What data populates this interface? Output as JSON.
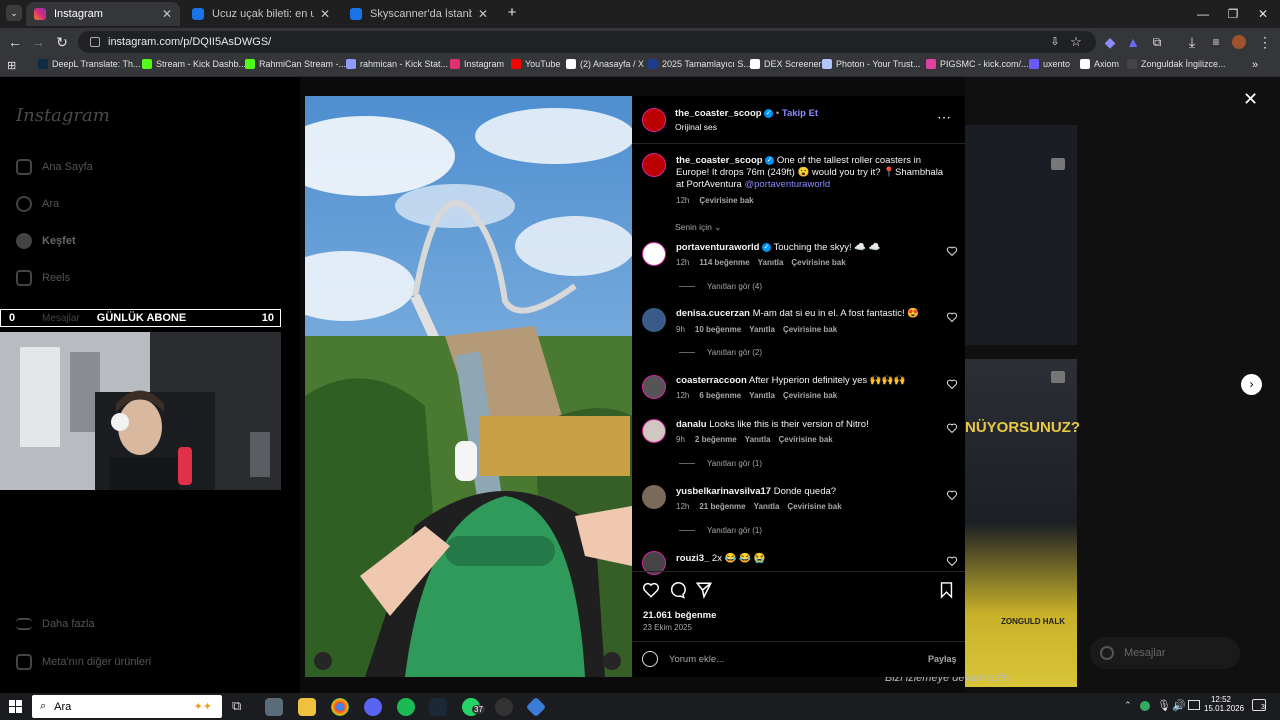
{
  "browser": {
    "tabs": [
      {
        "title": "Instagram",
        "active": true,
        "color": "#e1306c"
      },
      {
        "title": "Ucuz uçak bileti: en uygun uçak",
        "active": false,
        "color": "#1a73e8"
      },
      {
        "title": "Skyscanner'da İstanbul-Bakü a",
        "active": false,
        "color": "#1a73e8"
      }
    ],
    "url": "instagram.com/p/DQII5AsDWGS/"
  },
  "bookmarks": [
    {
      "label": "DeepL Translate: Th...",
      "color": "#0f2b46"
    },
    {
      "label": "Stream - Kick Dashb...",
      "color": "#53fc18"
    },
    {
      "label": "RahmiCan Stream -...",
      "color": "#53fc18"
    },
    {
      "label": "rahmican - Kick Stat...",
      "color": "#8f9bff"
    },
    {
      "label": "Instagram",
      "color": "#e1306c"
    },
    {
      "label": "YouTube",
      "color": "#ff0000"
    },
    {
      "label": "(2) Anasayfa / X",
      "color": "#ffffff"
    },
    {
      "label": "2025 Tamamlayıcı S...",
      "color": "#1a3d8f"
    },
    {
      "label": "DEX Screener",
      "color": "#ffffff"
    },
    {
      "label": "Photon - Your Trust...",
      "color": "#b0c4ff"
    },
    {
      "label": "PIGSMC - kick.com/...",
      "color": "#e040a0"
    },
    {
      "label": "uxento",
      "color": "#6b5bff"
    },
    {
      "label": "Axiom",
      "color": "#ffffff"
    },
    {
      "label": "Zonguldak İngilizce...",
      "color": "#444"
    }
  ],
  "instagram": {
    "logo": "Instagram",
    "nav": [
      "Ana Sayfa",
      "Ara",
      "Keşfet",
      "Reels",
      "Mesajlar",
      "Daha fazla",
      "Meta'nın diğer ürünleri"
    ],
    "messages_button": "Mesajlar",
    "bg_text_1": "NÜYORSUNUZ?",
    "bg_text_2": "Bizi izlemeye devam edin.",
    "bg_bus_text": "ZONGULD HALK"
  },
  "overlay": {
    "left": "0",
    "title": "GÜNLÜK ABONE",
    "right": "10"
  },
  "post": {
    "author": "the_coaster_scoop",
    "follow": "Takip Et",
    "audio": "Orijinal ses",
    "caption": "One of the tallest roller coasters in Europe! It drops 76m (249ft) 😮 would you try it? 📍Shambhala at PortAventura",
    "mention": "@portaventuraworld",
    "caption_time": "12h",
    "see_translation": "Çevirisine bak",
    "for_you": "Senin için",
    "likes": "21.061 beğenme",
    "date": "23 Ekim 2025",
    "comment_placeholder": "Yorum ekle...",
    "share": "Paylaş"
  },
  "comments": [
    {
      "user": "portaventuraworld",
      "verified": true,
      "text": "Touching the skyy! ☁️ ☁️",
      "time": "12h",
      "likes": "114 beğenme",
      "reply": "Yanıtla",
      "translate": "Çevirisine bak",
      "replies": "Yanıtları gör (4)",
      "avatar": "#ffffff"
    },
    {
      "user": "denisa.cucerzan",
      "verified": false,
      "text": "M-am dat si eu in el. A fost fantastic! 😍",
      "time": "9h",
      "likes": "10 beğenme",
      "reply": "Yanıtla",
      "translate": "Çevirisine bak",
      "replies": "Yanıtları gör (2)",
      "avatar": "#3a5a8a"
    },
    {
      "user": "coasterraccoon",
      "verified": false,
      "text": "After Hyperion definitely yes 🙌🙌🙌",
      "time": "12h",
      "likes": "6 beğenme",
      "reply": "Yanıtla",
      "translate": "Çevirisine bak",
      "replies": "",
      "avatar": "#555555"
    },
    {
      "user": "danalu",
      "verified": false,
      "text": "Looks like this is their version of Nitro!",
      "time": "9h",
      "likes": "2 beğenme",
      "reply": "Yanıtla",
      "translate": "Çevirisine bak",
      "replies": "Yanıtları gör (1)",
      "avatar": "#d0c8c0"
    },
    {
      "user": "yusbelkarinavsilva17",
      "verified": false,
      "text": "Donde queda?",
      "time": "12h",
      "likes": "21 beğenme",
      "reply": "Yanıtla",
      "translate": "Çevirisine bak",
      "replies": "Yanıtları gör (1)",
      "avatar": "#7a6a5a"
    },
    {
      "user": "rouzi3_",
      "verified": false,
      "text": "2x 😂 😂 😭",
      "time": "",
      "likes": "",
      "reply": "",
      "translate": "",
      "replies": "",
      "avatar": "#444444"
    }
  ],
  "taskbar": {
    "search": "Ara",
    "time": "12:52",
    "date": "15.01.2026",
    "whatsapp_badge": "37",
    "notif_badge": "3"
  }
}
